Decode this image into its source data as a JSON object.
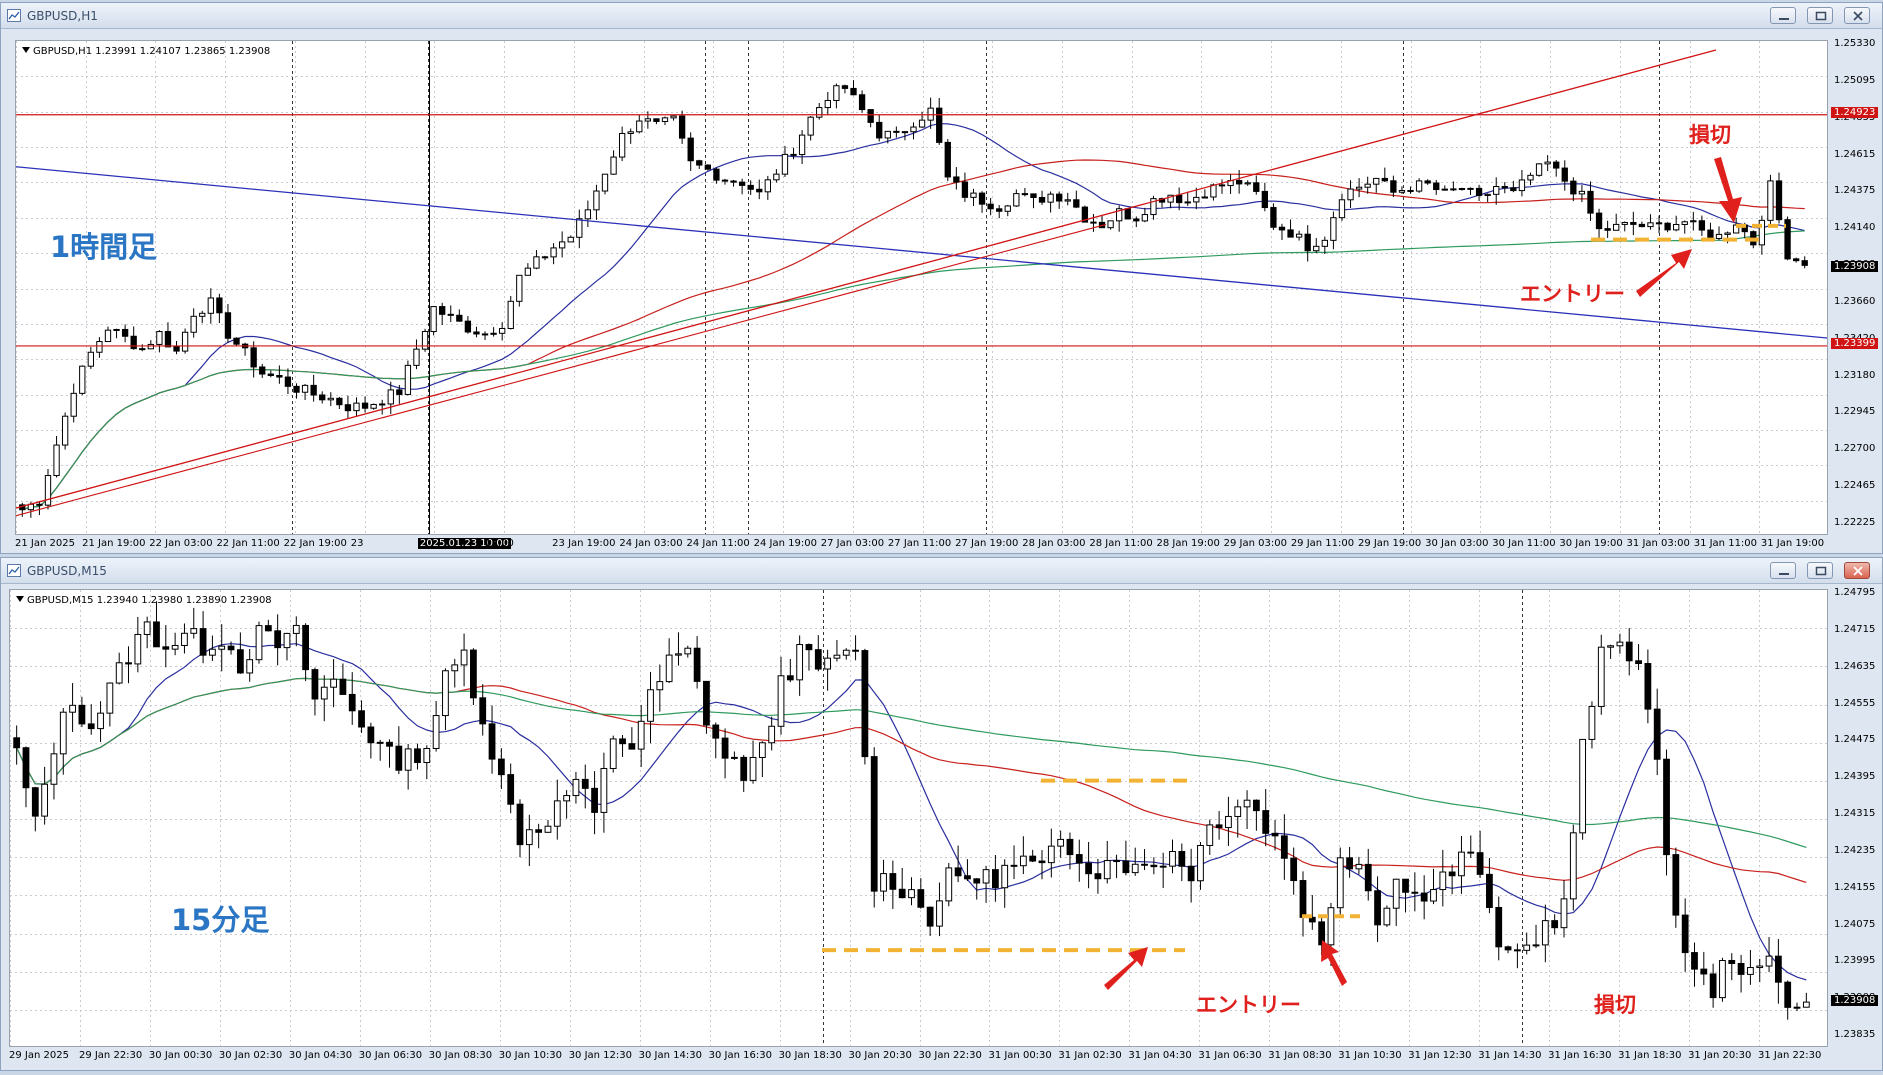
{
  "colors": {
    "bull": "#ffffff",
    "bear": "#000000",
    "grid": "#c7cbd1",
    "ma_fast": "#2b2f9e",
    "ma_mid": "#c8201c",
    "ma_slow": "#2f9a5e",
    "trend_blue": "#2b31b8",
    "hline_red": "#d01414",
    "dash_yellow": "#f2b233",
    "arrow_red": "#e0201c",
    "timeframe_text": "#2a76c4"
  },
  "windows": {
    "h1": {
      "title": "GBPUSD,H1",
      "info": "GBPUSD,H1  1.23991 1.24107 1.23865 1.23908",
      "price_labels": [
        "1.25330",
        "1.25095",
        "1.24855",
        "1.24615",
        "1.24375",
        "1.24140",
        "1.23908",
        "1.23660",
        "1.23420",
        "1.23180",
        "1.22945",
        "1.22700",
        "1.22465",
        "1.22225"
      ],
      "marked_levels": [
        {
          "value": "1.24923",
          "color": "red"
        },
        {
          "value": "1.23399",
          "color": "red"
        },
        {
          "value": "1.23908",
          "color": "black"
        }
      ],
      "time_labels": [
        "21 Jan 2025",
        "21 Jan 19:00",
        "22 Jan 03:00",
        "22 Jan 11:00",
        "22 Jan 19:00",
        "23",
        "2025.01.23 10:00",
        "11:00",
        "23 Jan 19:00",
        "24 Jan 03:00",
        "24 Jan 11:00",
        "24 Jan 19:00",
        "27 Jan 03:00",
        "27 Jan 11:00",
        "27 Jan 19:00",
        "28 Jan 03:00",
        "28 Jan 11:00",
        "28 Jan 19:00",
        "29 Jan 03:00",
        "29 Jan 11:00",
        "29 Jan 19:00",
        "30 Jan 03:00",
        "30 Jan 11:00",
        "30 Jan 19:00",
        "31 Jan 03:00",
        "31 Jan 11:00",
        "31 Jan 19:00"
      ],
      "annotations": {
        "timeframe": "1時間足",
        "entry": "エントリー",
        "stop": "損切"
      },
      "icons": [
        "chart-window-icon",
        "minimize-icon",
        "restore-icon",
        "close-icon"
      ]
    },
    "m15": {
      "title": "GBPUSD,M15",
      "info": "GBPUSD,M15  1.23940 1.23980 1.23890 1.23908",
      "price_labels": [
        "1.24795",
        "1.24715",
        "1.24635",
        "1.24555",
        "1.24475",
        "1.24395",
        "1.24315",
        "1.24235",
        "1.24155",
        "1.24075",
        "1.23995",
        "1.23908",
        "1.23835"
      ],
      "marked_levels": [
        {
          "value": "1.23908",
          "color": "black"
        }
      ],
      "time_labels": [
        "29 Jan 2025",
        "29 Jan 22:30",
        "30 Jan 00:30",
        "30 Jan 02:30",
        "30 Jan 04:30",
        "30 Jan 06:30",
        "30 Jan 08:30",
        "30 Jan 10:30",
        "30 Jan 12:30",
        "30 Jan 14:30",
        "30 Jan 16:30",
        "30 Jan 18:30",
        "30 Jan 20:30",
        "30 Jan 22:30",
        "31 Jan 00:30",
        "31 Jan 02:30",
        "31 Jan 04:30",
        "31 Jan 06:30",
        "31 Jan 08:30",
        "31 Jan 10:30",
        "31 Jan 12:30",
        "31 Jan 14:30",
        "31 Jan 16:30",
        "31 Jan 18:30",
        "31 Jan 20:30",
        "31 Jan 22:30"
      ],
      "annotations": {
        "timeframe": "15分足",
        "entry": "エントリー",
        "stop": "損切"
      },
      "icons": [
        "chart-window-icon",
        "minimize-icon",
        "restore-icon",
        "close-icon"
      ]
    }
  },
  "chart_data": [
    {
      "type": "candlestick",
      "symbol": "GBPUSD",
      "timeframe": "H1",
      "ohlc_last": {
        "open": 1.23991,
        "high": 1.24107,
        "low": 1.23865,
        "close": 1.23908
      },
      "ylim": [
        1.22225,
        1.2533
      ],
      "x_ticks": [
        "21 Jan 2025",
        "21 Jan 19:00",
        "22 Jan 03:00",
        "22 Jan 11:00",
        "22 Jan 19:00",
        "23",
        "11:00",
        "23 Jan 19:00",
        "24 Jan 03:00",
        "24 Jan 11:00",
        "24 Jan 19:00",
        "27 Jan 03:00",
        "27 Jan 11:00",
        "27 Jan 19:00",
        "28 Jan 03:00",
        "28 Jan 11:00",
        "28 Jan 19:00",
        "29 Jan 03:00",
        "29 Jan 11:00",
        "29 Jan 19:00",
        "30 Jan 03:00",
        "30 Jan 11:00",
        "30 Jan 19:00",
        "31 Jan 03:00",
        "31 Jan 11:00",
        "31 Jan 19:00"
      ],
      "close_path": [
        1.2232,
        1.2238,
        1.2275,
        1.2312,
        1.2335,
        1.2352,
        1.2345,
        1.2338,
        1.2348,
        1.2336,
        1.2362,
        1.2368,
        1.2348,
        1.2335,
        1.2322,
        1.2318,
        1.2312,
        1.2308,
        1.2305,
        1.23,
        1.23,
        1.2305,
        1.231,
        1.2338,
        1.2365,
        1.2358,
        1.2352,
        1.2348,
        1.2355,
        1.2385,
        1.2395,
        1.2405,
        1.2412,
        1.243,
        1.2455,
        1.2478,
        1.249,
        1.2485,
        1.2488,
        1.246,
        1.2456,
        1.245,
        1.2448,
        1.244,
        1.2455,
        1.247,
        1.249,
        1.2505,
        1.251,
        1.2495,
        1.248,
        1.2478,
        1.2488,
        1.2495,
        1.245,
        1.244,
        1.2436,
        1.2432,
        1.244,
        1.2435,
        1.244,
        1.2438,
        1.2425,
        1.242,
        1.2428,
        1.2425,
        1.2436,
        1.244,
        1.2435,
        1.2442,
        1.2446,
        1.2448,
        1.244,
        1.242,
        1.2415,
        1.2406,
        1.2412,
        1.244,
        1.2445,
        1.245,
        1.2441,
        1.2445,
        1.2446,
        1.244,
        1.2444,
        1.2436,
        1.2445,
        1.244,
        1.2452,
        1.246,
        1.2449,
        1.2438,
        1.2416,
        1.2418,
        1.242,
        1.2418,
        1.242,
        1.2422,
        1.2415,
        1.2412,
        1.2422,
        1.2408,
        1.2445,
        1.2401,
        1.2393
      ],
      "series": [
        {
          "name": "horizontal line",
          "value": 1.24923
        },
        {
          "name": "horizontal line",
          "value": 1.23399
        }
      ],
      "annotations": [
        {
          "text": "1時間足"
        },
        {
          "text": "エントリー",
          "price": 1.241
        },
        {
          "text": "損切",
          "price": 1.2418
        }
      ]
    },
    {
      "type": "candlestick",
      "symbol": "GBPUSD",
      "timeframe": "M15",
      "ohlc_last": {
        "open": 1.2394,
        "high": 1.2398,
        "low": 1.2389,
        "close": 1.23908
      },
      "ylim": [
        1.23835,
        1.24795
      ],
      "x_ticks": [
        "29 Jan 2025",
        "29 Jan 22:30",
        "30 Jan 00:30",
        "30 Jan 02:30",
        "30 Jan 04:30",
        "30 Jan 06:30",
        "30 Jan 08:30",
        "30 Jan 10:30",
        "30 Jan 12:30",
        "30 Jan 14:30",
        "30 Jan 16:30",
        "30 Jan 18:30",
        "30 Jan 20:30",
        "30 Jan 22:30",
        "31 Jan 00:30",
        "31 Jan 02:30",
        "31 Jan 04:30",
        "31 Jan 06:30",
        "31 Jan 08:30",
        "31 Jan 10:30",
        "31 Jan 12:30",
        "31 Jan 14:30",
        "31 Jan 16:30",
        "31 Jan 18:30",
        "31 Jan 20:30",
        "31 Jan 22:30"
      ],
      "close_path": [
        1.2446,
        1.243,
        1.2448,
        1.2458,
        1.2452,
        1.246,
        1.2468,
        1.2474,
        1.247,
        1.2472,
        1.247,
        1.2472,
        1.2466,
        1.2472,
        1.247,
        1.2472,
        1.2458,
        1.2462,
        1.2456,
        1.245,
        1.2445,
        1.2445,
        1.2448,
        1.2462,
        1.2468,
        1.2454,
        1.244,
        1.2428,
        1.243,
        1.2434,
        1.244,
        1.2432,
        1.245,
        1.2448,
        1.2458,
        1.2466,
        1.2468,
        1.2454,
        1.2445,
        1.2442,
        1.2446,
        1.2462,
        1.2468,
        1.2465,
        1.2466,
        1.247,
        1.2418,
        1.2418,
        1.2415,
        1.241,
        1.2418,
        1.2419,
        1.2418,
        1.242,
        1.2422,
        1.242,
        1.2426,
        1.2424,
        1.242,
        1.2424,
        1.242,
        1.2422,
        1.2424,
        1.242,
        1.243,
        1.2434,
        1.2436,
        1.243,
        1.2424,
        1.2412,
        1.2403,
        1.2424,
        1.2422,
        1.241,
        1.2418,
        1.2414,
        1.2418,
        1.242,
        1.2425,
        1.241,
        1.24,
        1.2403,
        1.2408,
        1.2412,
        1.2447,
        1.2467,
        1.2472,
        1.2466,
        1.2442,
        1.241,
        1.2397,
        1.2394,
        1.2402,
        1.2396,
        1.24,
        1.2392,
        1.2391
      ],
      "annotations": [
        {
          "text": "15分足"
        },
        {
          "text": "エントリー",
          "price": 1.2404
        },
        {
          "text": "損切",
          "price": 1.241
        }
      ]
    }
  ]
}
